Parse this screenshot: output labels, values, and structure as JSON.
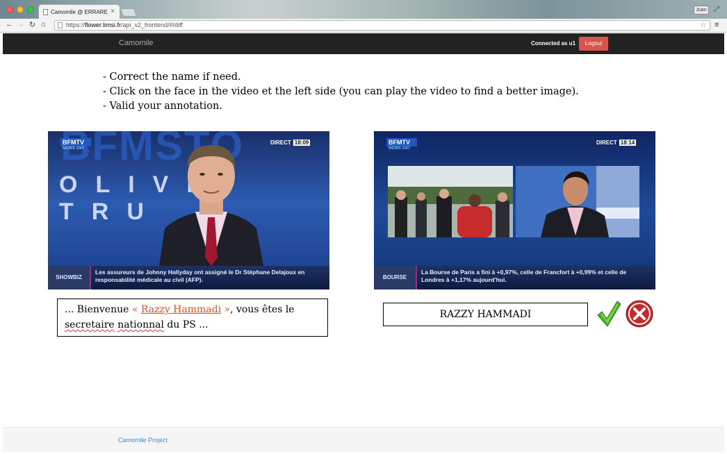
{
  "browser": {
    "tab_title": "Camomile @ ERRARE",
    "tab_close": "×",
    "profile_name": "Juan",
    "url_prefix": "https://",
    "url_host": "flower.limsi.fr",
    "url_path": "/api_v2_frontend/#/diff",
    "icons": [
      "back-icon",
      "forward-icon",
      "reload-icon",
      "home-icon",
      "page-icon",
      "star-icon",
      "menu-icon"
    ]
  },
  "navbar": {
    "brand": "Camomile",
    "connected_as": "Connected as u1",
    "logout_label": "Logout",
    "logout_color": "#d9534f"
  },
  "instructions": [
    "- Correct the name if need.",
    "- Click on the face in the video et the left side (you can play the video to find a better image).",
    "- Valid your annotation."
  ],
  "left_video": {
    "channel_logo_top": "BFMTV",
    "channel_logo_bottom": "NEWS 24/7",
    "background_text": "BFMSTO",
    "overlay_text": "OLIVI  TRU",
    "direct_label": "DIRECT",
    "direct_time": "18:09",
    "ticker_category": "SHOWBIZ",
    "ticker_text": "Les assureurs de Johnny Hallyday ont assigné le Dr Stéphane Delajoux en responsabilité médicale au civil (AFP)."
  },
  "right_video": {
    "channel_logo_top": "BFMTV",
    "channel_logo_bottom": "NEWS 24/7",
    "direct_label": "DIRECT",
    "direct_time": "18:14",
    "ticker_category": "BOURSE",
    "ticker_text": "La Bourse de Paris a fini à +0,97%, celle de Francfort à +0,99% et celle de Londres à +1,17% aujourd'hui."
  },
  "transcript": {
    "before": "... Bienvenue ",
    "name_open": "« ",
    "name": "Razzy Hammadi",
    "name_close": " »",
    "after_name": ", vous êtes le",
    "line2_word1": "secretaire",
    "line2_space": " ",
    "line2_word2": "nationnal",
    "line2_rest": " du PS ..."
  },
  "name_field_value": "RAZZY HAMMADI",
  "actions": {
    "validate_icon": "check-icon",
    "validate_color": "#4caf2a",
    "cancel_icon": "cancel-icon",
    "cancel_color": "#c62828"
  },
  "footer": {
    "link_label": "Camomile Project"
  }
}
